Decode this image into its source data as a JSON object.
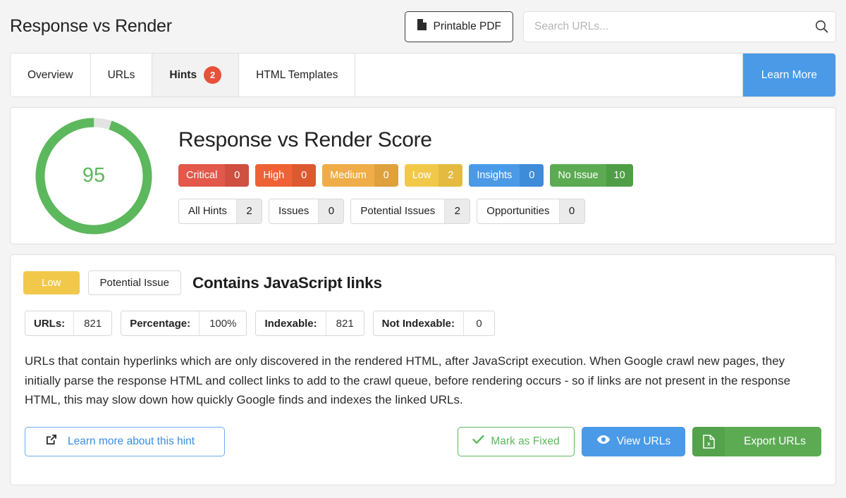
{
  "header": {
    "title": "Response vs Render",
    "pdf_button": "Printable PDF",
    "search_placeholder": "Search URLs...",
    "search_value": ""
  },
  "tabs": {
    "items": [
      {
        "label": "Overview",
        "badge": null,
        "active": false
      },
      {
        "label": "URLs",
        "badge": null,
        "active": false
      },
      {
        "label": "Hints",
        "badge": "2",
        "active": true
      },
      {
        "label": "HTML Templates",
        "badge": null,
        "active": false
      }
    ],
    "learn_more": "Learn More"
  },
  "score": {
    "heading": "Response vs Render Score",
    "value": "95",
    "percent": 95,
    "ring_color": "#5cb85c",
    "ring_track_color": "#e3e3e3",
    "severities": [
      {
        "label": "Critical",
        "count": "0",
        "color": "#e2584a",
        "count_color": "#cf4f41"
      },
      {
        "label": "High",
        "count": "0",
        "color": "#ee6236",
        "count_color": "#dd5a31"
      },
      {
        "label": "Medium",
        "count": "0",
        "color": "#efad48",
        "count_color": "#dea13e"
      },
      {
        "label": "Low",
        "count": "2",
        "color": "#f2c84b",
        "count_color": "#e3bb40"
      },
      {
        "label": "Insights",
        "count": "0",
        "color": "#4a9ae8",
        "count_color": "#3d8bd9"
      },
      {
        "label": "No Issue",
        "count": "10",
        "color": "#5cab53",
        "count_color": "#4f9e47"
      }
    ],
    "filters": [
      {
        "label": "All Hints",
        "count": "2"
      },
      {
        "label": "Issues",
        "count": "0"
      },
      {
        "label": "Potential Issues",
        "count": "2"
      },
      {
        "label": "Opportunities",
        "count": "0"
      }
    ]
  },
  "hint": {
    "severity_pill": "Low",
    "type_pill": "Potential Issue",
    "title": "Contains JavaScript links",
    "metrics": [
      {
        "label": "URLs:",
        "value": "821"
      },
      {
        "label": "Percentage:",
        "value": "100%"
      },
      {
        "label": "Indexable:",
        "value": "821"
      },
      {
        "label": "Not Indexable:",
        "value": "0"
      }
    ],
    "description": "URLs that contain hyperlinks which are only discovered in the rendered HTML, after JavaScript execution. When Google crawl new pages, they initially parse the response HTML and collect links to add to the crawl queue, before rendering occurs - so if links are not present in the response HTML, this may slow down how quickly Google finds and indexes the linked URLs.",
    "actions": {
      "learn_more": "Learn more about this hint",
      "mark_fixed": "Mark as Fixed",
      "view_urls": "View URLs",
      "export_urls": "Export URLs"
    }
  }
}
